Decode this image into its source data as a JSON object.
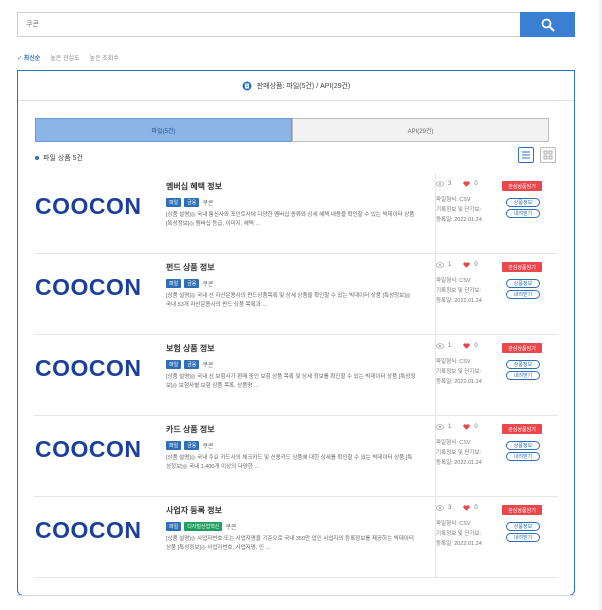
{
  "search": {
    "placeholder": "쿠콘"
  },
  "sort": {
    "options": [
      "✓ 최신순",
      "높은 관심도",
      "높은 조회수"
    ]
  },
  "panel": {
    "header": "판매상품: 파일(5건) / API(29건)"
  },
  "tabs": [
    "파일(5건)",
    "API(29건)"
  ],
  "count_label": "파일 상품 5건",
  "meta_labels": {
    "format": "파일형식: CSV",
    "period": "기록정보 및 단기보:",
    "date": "등록일: 2022.01.24",
    "detail_btn": "관심상품담기",
    "pill1": "상품정보",
    "pill2": "내려받기"
  },
  "items": [
    {
      "title": "멤버십 혜택 정보",
      "badges": [
        "파일",
        "금융"
      ],
      "provider": "쿠콘",
      "desc": "[상품 설명]◎ 국내 통신사와 포인트사에 다양한 멤버십 종류와 상세 혜택 내용을 확인할 수 있는 빅데이터 상품 [특성정보]◎ 멤버십 등급, 이미지, 혜택 ...",
      "views": "3",
      "likes": "0"
    },
    {
      "title": "펀드 상품 정보",
      "badges": [
        "파일",
        "금융"
      ],
      "provider": "쿠콘",
      "desc": "[상품 설명]◎ 국내 선 자산운용사의 펀드상품목록 및 상세 상품을 확인할 수 있는 빅데이터 상품 [특성정보]◎ 국내 53개 자산운용사의 펀드 상품 목록과 ...",
      "views": "1",
      "likes": "0"
    },
    {
      "title": "보험 상품 정보",
      "badges": [
        "파일",
        "금융"
      ],
      "provider": "쿠콘",
      "desc": "[상품 설명]◎ 국내 선 보험사가 판매 중인 보험 상품 목록 및 상세 정보를 확인할 수 있는 빅데이터 상품 [특성정보]◎ 보험사별 보험 상품 목록, 상품명 ...",
      "views": "1",
      "likes": "0"
    },
    {
      "title": "카드 상품 정보",
      "badges": [
        "파일",
        "금융"
      ],
      "provider": "쿠콘",
      "desc": "[상품 설명]◎ 국내 주요 카드사의 체크카드 및 신용카드 상품에 대한 상세를 확인할 수 있는 빅데이터 상품 [특성정보]◎ 국내 1,400개 이상의 다양한 ...",
      "views": "1",
      "likes": "0"
    },
    {
      "title": "사업자 등록 정보",
      "badges": [
        "파일",
        "디지털산업혁신"
      ],
      "provider": "쿠콘",
      "desc": "[상품 설명]◎ 사업자번호 또는 사업자명을 기준으로 국내 350만 업인 사업자의 등록정보를 제공하는 빅데이터 상품 [특성정보]◎ 사업자번호, 사업자명, 인 ...",
      "views": "3",
      "likes": "0"
    }
  ],
  "logo": {
    "text": "COOCON",
    "color": "#1b3f9a"
  },
  "colors": {
    "accent": "#2f6fb8",
    "danger": "#e8484b",
    "tab_active": "#8bb5e6"
  }
}
